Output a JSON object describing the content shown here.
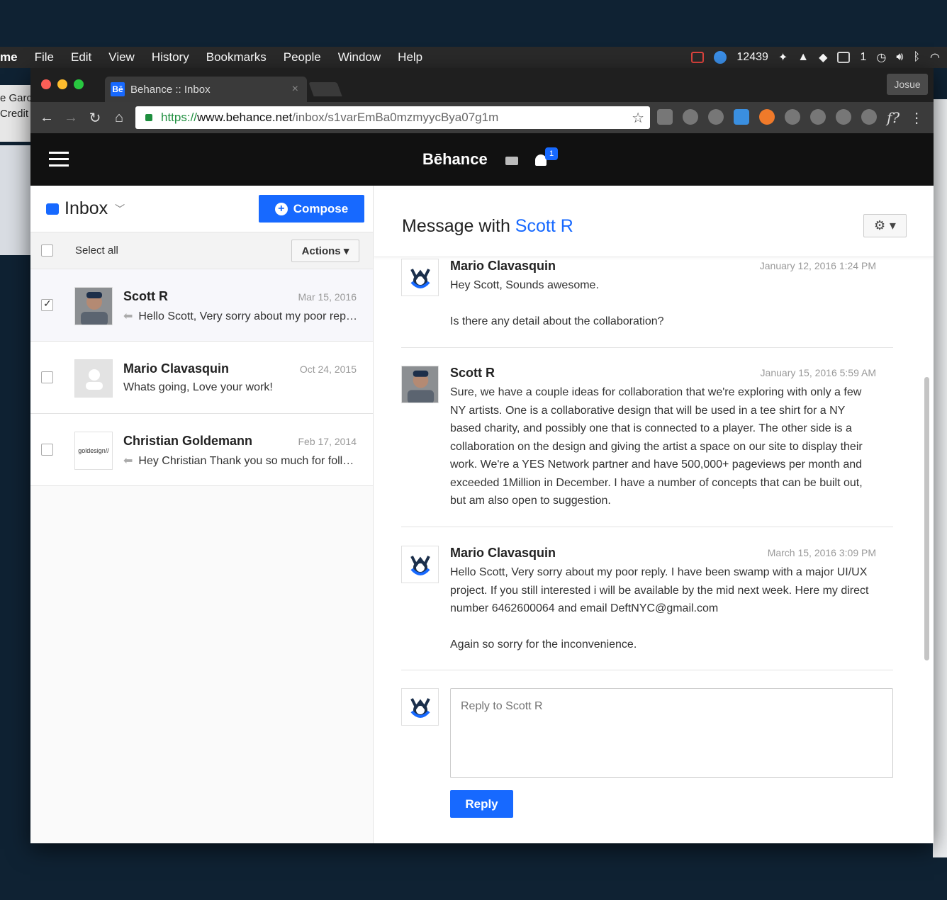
{
  "menubar": {
    "app": "me",
    "items": [
      "File",
      "Edit",
      "View",
      "History",
      "Bookmarks",
      "People",
      "Window",
      "Help"
    ],
    "counter": "12439",
    "badge_number": "1"
  },
  "bg_window": {
    "line1": "e Garc",
    "line2": "Credit"
  },
  "browser": {
    "tab_title": "Behance :: Inbox",
    "tab_favicon": "Bē",
    "tab_close": "×",
    "profile": "Josue",
    "url_scheme": "https://",
    "url_host": "www.behance.net",
    "url_path": "/inbox/s1varEmBa0mzmyycBya07g1m",
    "fx_label": "f?"
  },
  "header": {
    "logo": "Bēhance",
    "notification_count": "1"
  },
  "inbox": {
    "title": "Inbox",
    "compose_label": "Compose",
    "select_all": "Select all",
    "actions_label": "Actions ▾",
    "threads": [
      {
        "name": "Scott R",
        "date": "Mar 15, 2016",
        "snippet": "Hello Scott, Very sorry about my poor reply. I have been swamp with a major",
        "replied": true,
        "checked": true
      },
      {
        "name": "Mario Clavasquin",
        "date": "Oct 24, 2015",
        "snippet": "Whats going, Love your work!",
        "replied": false,
        "checked": false
      },
      {
        "name": "Christian Goldemann",
        "date": "Feb 17, 2014",
        "snippet": "Hey Christian Thank you so much for following me",
        "replied": true,
        "checked": false,
        "avatar_text": "goldesign//"
      }
    ]
  },
  "conversation": {
    "title_prefix": "Message with ",
    "title_name": "Scott R",
    "gear_label": "⚙ ▾",
    "messages": [
      {
        "sender": "Mario Clavasquin",
        "date": "January 12, 2016 1:24 PM",
        "body": "Hey Scott, Sounds awesome.\n\nIs there any detail about the collaboration?"
      },
      {
        "sender": "Scott R",
        "date": "January 15, 2016 5:59 AM",
        "body": "Sure, we have a couple ideas for collaboration that we're exploring with only a few NY artists. One is a collaborative design that will be used in a tee shirt for a NY based charity, and possibly one that is connected to a player. The other side is a collaboration on the design and giving the artist a space on our site to display their work. We're a YES Network partner and have 500,000+ pageviews per month and exceeded 1Million in December. I have a number of concepts that can be built out, but am also open to suggestion."
      },
      {
        "sender": "Mario Clavasquin",
        "date": "March 15, 2016 3:09 PM",
        "body": "Hello Scott, Very sorry about my poor reply. I have been swamp with a major UI/UX project. If you still interested i will be available by the mid next week. Here my direct number 6462600064 and email DeftNYC@gmail.com\n\nAgain so sorry for the inconvenience."
      }
    ],
    "reply_placeholder": "Reply to Scott R",
    "reply_button": "Reply"
  }
}
